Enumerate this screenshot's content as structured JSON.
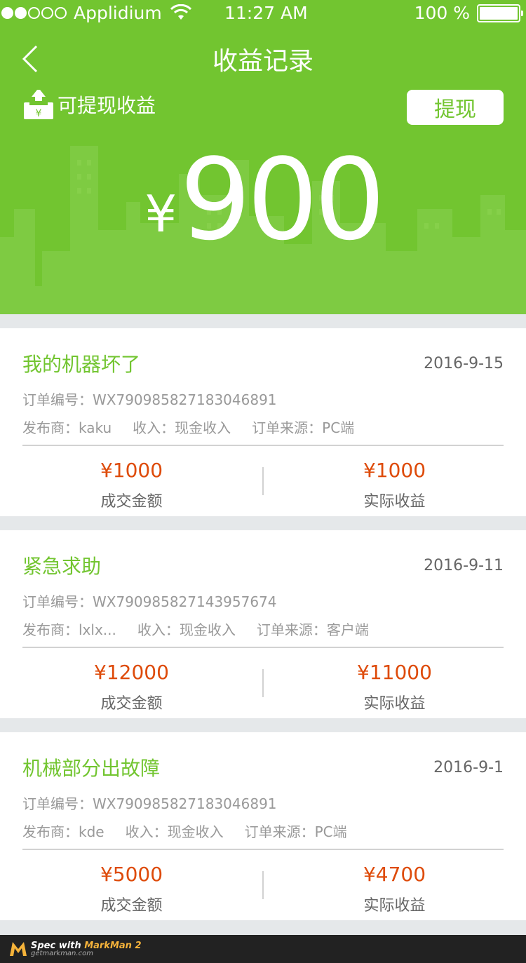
{
  "status_bar": {
    "carrier": "Applidium",
    "time": "11:27 AM",
    "battery": "100 %",
    "signal_icon": "signal-dots-icon",
    "wifi_icon": "wifi-icon",
    "battery_icon": "battery-icon"
  },
  "header": {
    "back_icon": "chevron-left-icon",
    "title": "收益记录",
    "withdrawable_icon": "tray-upload-icon",
    "withdrawable_label": "可提现收益",
    "withdraw_button": "提现",
    "currency": "¥",
    "amount": "900",
    "bg_color": "#72c530"
  },
  "records": [
    {
      "title": "我的机器坏了",
      "date": "2016-9-15",
      "order_no": "订单编号：WX790985827183046891",
      "publisher": "发布商：kaku",
      "income": "收入：现金收入",
      "source": "订单来源：PC端",
      "deal_amount": "¥1000",
      "deal_label": "成交金额",
      "actual_amount": "¥1000",
      "actual_label": "实际收益"
    },
    {
      "title": "紧急求助",
      "date": "2016-9-11",
      "order_no": "订单编号：WX790985827143957674",
      "publisher": "发布商：lxlx...",
      "income": "收入：现金收入",
      "source": "订单来源：客户端",
      "deal_amount": "¥12000",
      "deal_label": "成交金额",
      "actual_amount": "¥11000",
      "actual_label": "实际收益"
    },
    {
      "title": "机械部分出故障",
      "date": "2016-9-1",
      "order_no": "订单编号：WX790985827183046891",
      "publisher": "发布商：kde",
      "income": "收入：现金收入",
      "source": "订单来源：PC端",
      "deal_amount": "¥5000",
      "deal_label": "成交金额",
      "actual_amount": "¥4700",
      "actual_label": "实际收益"
    }
  ],
  "colors": {
    "accent_green": "#72c530",
    "amount_orange": "#de4b0a",
    "divider": "#d2d2d2",
    "page_bg": "#e5e8ea",
    "text_dark": "#666666",
    "text_light": "#999999"
  },
  "footer": {
    "logo_icon": "markman-logo-icon",
    "title_prefix": "Spec with",
    "title_brand": "MarkMan 2",
    "subtitle": "getmarkman.com"
  }
}
